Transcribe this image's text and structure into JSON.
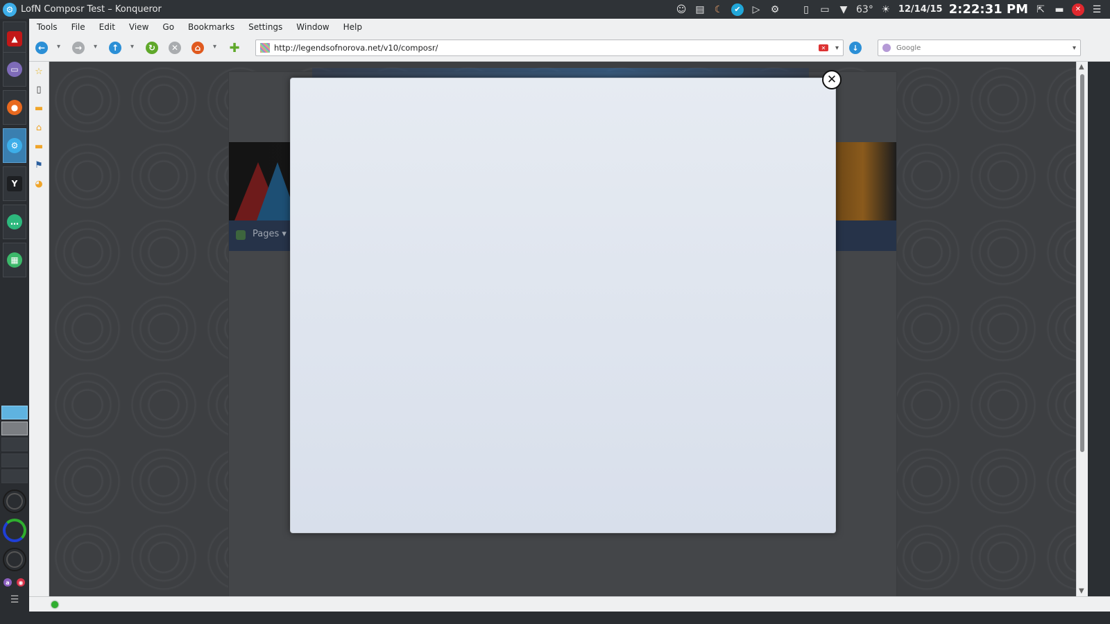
{
  "window": {
    "title": "LofN Composr Test – Konqueror"
  },
  "system_tray": {
    "temperature": "63°",
    "date": "12/14/15",
    "time": "2:22:31 PM"
  },
  "menu": {
    "items": [
      "Tools",
      "File",
      "Edit",
      "View",
      "Go",
      "Bookmarks",
      "Settings",
      "Window",
      "Help"
    ]
  },
  "toolbar": {
    "url": "http://legendsofnorova.net/v10/composr/",
    "search_placeholder": "Google"
  },
  "site": {
    "nav_label": "Pages ▾"
  },
  "modal": {
    "close_glyph": "✕"
  },
  "colors": {
    "accent": "#3daee9",
    "chrome": "#eff0f1",
    "modal_top": "#e6ebf2",
    "modal_bottom": "#d8dfeb"
  }
}
